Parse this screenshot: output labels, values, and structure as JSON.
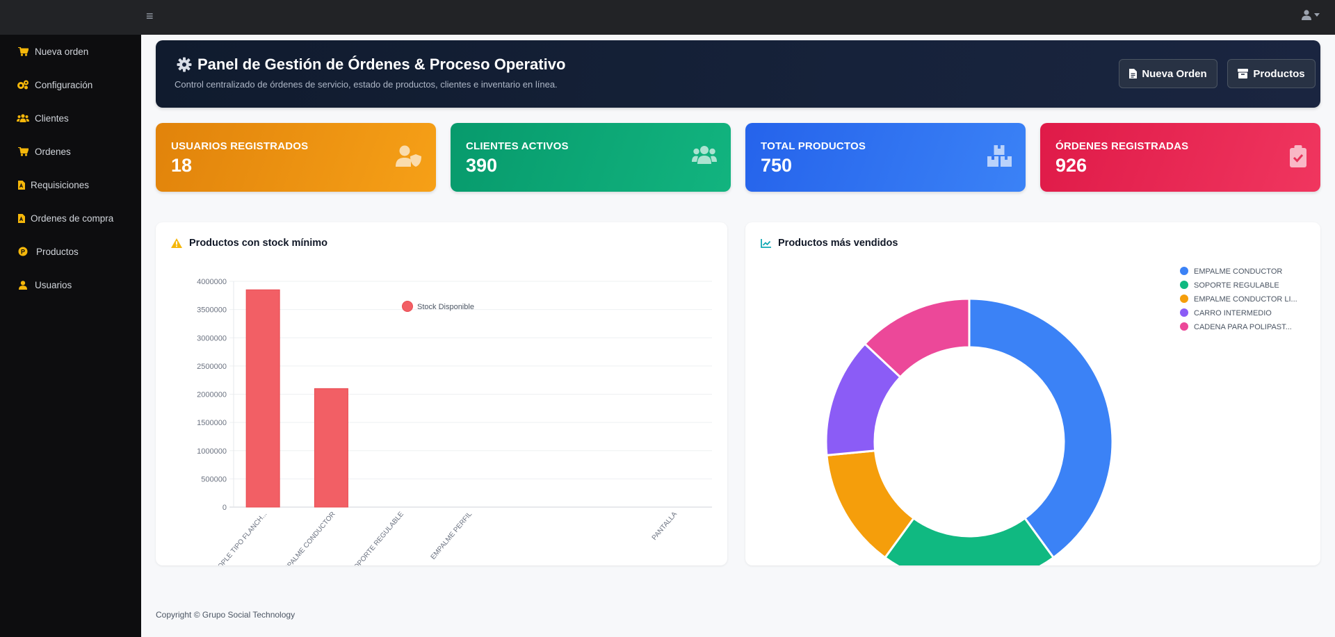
{
  "topbar": {
    "menu_glyph": "≡",
    "menu_icon": "hamburger-icon",
    "user_icon": "user-icon"
  },
  "sidebar": {
    "items": [
      {
        "label": "Nueva orden",
        "icon": "cart-icon"
      },
      {
        "label": "Configuración",
        "icon": "gears-icon"
      },
      {
        "label": "Clientes",
        "icon": "users-icon"
      },
      {
        "label": "Ordenes",
        "icon": "cart-icon"
      },
      {
        "label": "Requisiciones",
        "icon": "pdf-file-icon"
      },
      {
        "label": "Ordenes de compra",
        "icon": "pdf-file-icon"
      },
      {
        "label": "Productos",
        "icon": "product-badge-icon"
      },
      {
        "label": "Usuarios",
        "icon": "user-icon"
      }
    ],
    "icon_color": "#f5b70a"
  },
  "header": {
    "title": "Panel de Gestión de Órdenes & Proceso Operativo",
    "subtitle": "Control centralizado de órdenes de servicio, estado de productos, clientes e inventario en línea.",
    "buttons": {
      "new_order": "Nueva Orden",
      "products": "Productos"
    }
  },
  "stats": [
    {
      "label": "USUARIOS REGISTRADOS",
      "value": "18",
      "icon": "user-shield-icon",
      "color": "#e8890c"
    },
    {
      "label": "CLIENTES ACTIVOS",
      "value": "390",
      "icon": "users-icon",
      "color": "#0fa876"
    },
    {
      "label": "TOTAL PRODUCTOS",
      "value": "750",
      "icon": "boxes-icon",
      "color": "#2f6ef0"
    },
    {
      "label": "ÓRDENES REGISTRADAS",
      "value": "926",
      "icon": "clipboard-check-icon",
      "color": "#e41d50"
    }
  ],
  "stock_card": {
    "title": "Productos con stock mínimo",
    "icon": "warning-icon"
  },
  "sales_card": {
    "title": "Productos más vendidos",
    "icon": "line-chart-icon"
  },
  "chart_data": [
    {
      "type": "bar",
      "categories": [
        "ACOPLE TIPO FLANCH...",
        "EMPALME CONDUCTOR",
        "SOPORTE REGULABLE",
        "EMPALME PERFIL",
        "",
        "",
        "PANTALLA"
      ],
      "series": [
        {
          "name": "Stock Disponible",
          "values": [
            3850000,
            2100000,
            0,
            0,
            0,
            0,
            0
          ],
          "color": "#f25f65"
        }
      ],
      "yticks": [
        0,
        500000,
        1000000,
        1500000,
        2000000,
        2500000,
        3000000,
        3500000,
        4000000
      ],
      "ylim": [
        0,
        4000000
      ],
      "grid": true,
      "legend": "top"
    },
    {
      "type": "pie",
      "donut": true,
      "labels": [
        "EMPALME CONDUCTOR",
        "SOPORTE REGULABLE",
        "EMPALME CONDUCTOR LI...",
        "CARRO INTERMEDIO",
        "CADENA PARA POLIPAST..."
      ],
      "values": [
        40,
        20,
        13.5,
        13.5,
        13
      ],
      "colors": [
        "#3b82f6",
        "#10b981",
        "#f59e0b",
        "#8b5cf6",
        "#ec4899"
      ],
      "legend": "right"
    }
  ],
  "footer": {
    "text": "Copyright © Grupo Social Technology"
  }
}
